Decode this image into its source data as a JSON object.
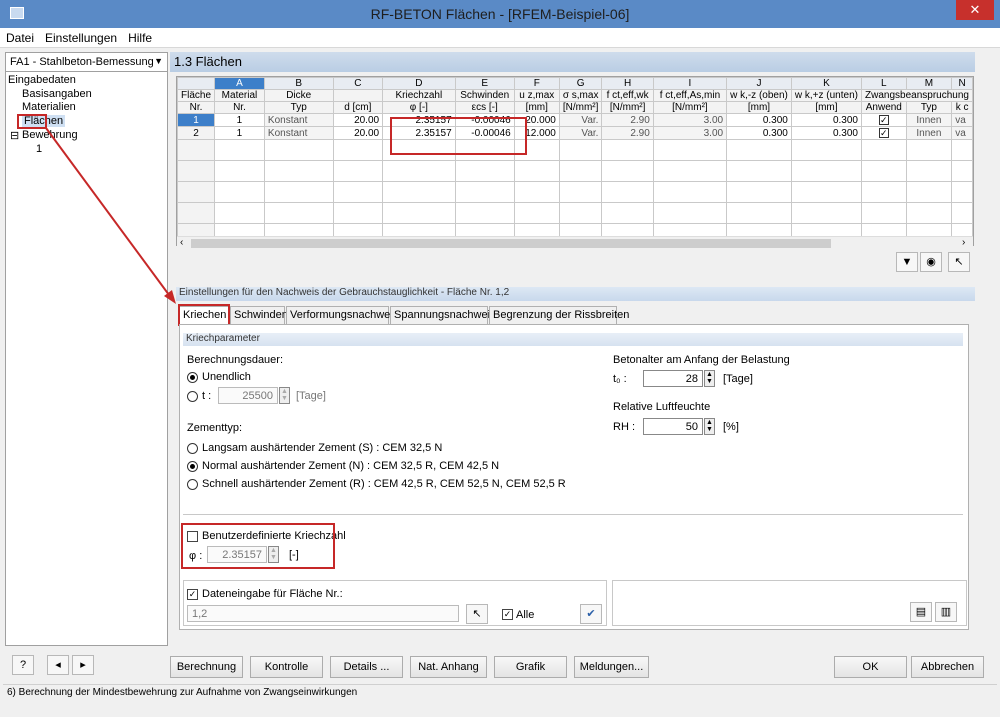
{
  "window": {
    "title": "RF-BETON Flächen - [RFEM-Beispiel-06]",
    "close": "✕"
  },
  "menu": [
    "Datei",
    "Einstellungen",
    "Hilfe"
  ],
  "sidebar": {
    "case": "FA1 - Stahlbeton-Bemessung",
    "root": "Eingabedaten",
    "items": [
      "Basisangaben",
      "Materialien",
      "Flächen",
      "Bewehrung",
      "1"
    ]
  },
  "section_title": "1.3 Flächen",
  "table": {
    "col_letters": [
      "A",
      "B",
      "C",
      "D",
      "E",
      "F",
      "G",
      "H",
      "I",
      "J",
      "K",
      "L",
      "M",
      "N"
    ],
    "header1": [
      "Fläche",
      "Material",
      "Dicke",
      "",
      "Kriechzahl",
      "Schwinden",
      "u z,max",
      "σ s,max",
      "f ct,eff,wk",
      "f ct,eff,As,min",
      "w k,-z (oben)",
      "w k,+z (unten)",
      "Zwangsbeanspruchung",
      "",
      ""
    ],
    "header2": [
      "Nr.",
      "Nr.",
      "Typ",
      "d [cm]",
      "φ [-]",
      "εcs [-]",
      "[mm]",
      "[N/mm²]",
      "[N/mm²]",
      "[N/mm²]",
      "[mm]",
      "[mm]",
      "Anwend",
      "Typ",
      "k c"
    ],
    "rows": [
      [
        "1",
        "1",
        "Konstant",
        "20.00",
        "2.35157",
        "-0.00046",
        "20.000",
        "Var.",
        "2.90",
        "3.00",
        "0.300",
        "0.300",
        "✓",
        "Innen",
        "va"
      ],
      [
        "2",
        "1",
        "Konstant",
        "20.00",
        "2.35157",
        "-0.00046",
        "12.000",
        "Var.",
        "2.90",
        "3.00",
        "0.300",
        "0.300",
        "✓",
        "Innen",
        "va"
      ]
    ]
  },
  "settings_title": "Einstellungen für den Nachweis der Gebrauchstauglichkeit - Fläche Nr. 1,2",
  "tabs": [
    "Kriechen",
    "Schwinden",
    "Verformungsnachweis",
    "Spannungsnachweis",
    "Begrenzung der Rissbreiten"
  ],
  "kriechen": {
    "group_title": "Kriechparameter",
    "berechnungsdauer_label": "Berechnungsdauer:",
    "unendlich": "Unendlich",
    "t_label": "t :",
    "t_value": "25500",
    "t_unit": "[Tage]",
    "zementtyp_label": "Zementtyp:",
    "zement_options": [
      "Langsam aushärtender Zement (S) : CEM 32,5 N",
      "Normal aushärtender Zement (N) : CEM 32,5 R, CEM 42,5 N",
      "Schnell aushärtender Zement (R) : CEM 42,5 R, CEM 52,5 N, CEM 52,5 R"
    ],
    "betonalter_label": "Betonalter am Anfang der Belastung",
    "t0_label": "t₀ :",
    "t0_value": "28",
    "t0_unit": "[Tage]",
    "luftfeuchte_label": "Relative Luftfeuchte",
    "rh_label": "RH :",
    "rh_value": "50",
    "rh_unit": "[%]",
    "custom_label": "Benutzerdefinierte Kriechzahl",
    "phi_label": "φ :",
    "phi_value": "2.35157",
    "phi_unit": "[-]"
  },
  "dateneingabe": {
    "label": "Dateneingabe für Fläche Nr.:",
    "value": "1,2",
    "alle": "Alle"
  },
  "buttons": [
    "Berechnung",
    "Kontrolle",
    "Details ...",
    "Nat. Anhang",
    "Grafik",
    "Meldungen...",
    "OK",
    "Abbrechen"
  ],
  "status": "6) Berechnung der Mindestbewehrung zur Aufnahme von Zwangseinwirkungen",
  "colors": {
    "titlebar": "#5a8ac6",
    "selection": "#3d7fc9",
    "highlight": "#c62828"
  }
}
